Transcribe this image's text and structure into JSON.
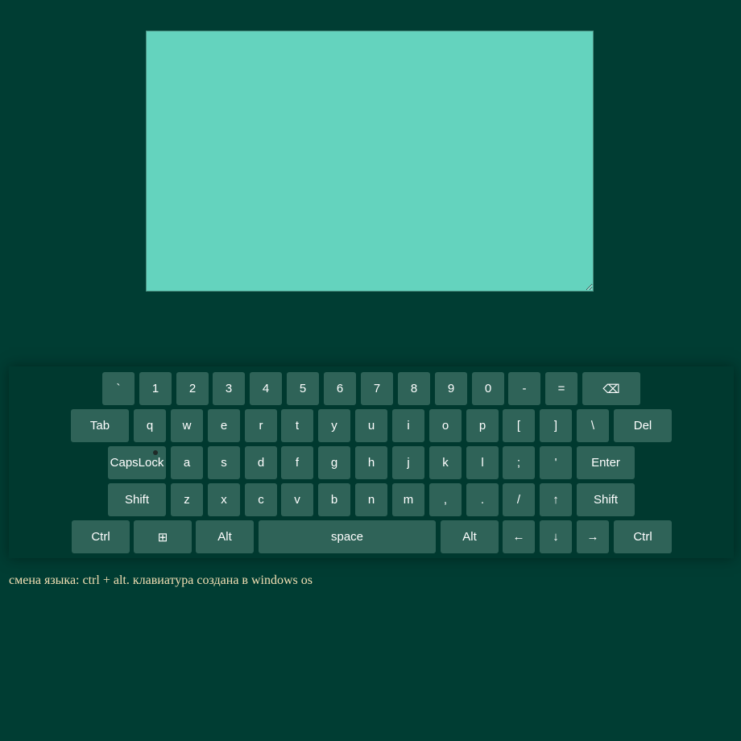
{
  "colors": {
    "background": "#003d33",
    "textarea": "#64d3be",
    "keyboard_panel": "#00392f",
    "key": "#2f6358",
    "key_text": "#ffffff",
    "note_text": "#f2dfb3"
  },
  "textarea": {
    "value": ""
  },
  "keyboard": {
    "rows": [
      [
        "`",
        "1",
        "2",
        "3",
        "4",
        "5",
        "6",
        "7",
        "8",
        "9",
        "0",
        "-",
        "=",
        "⌫"
      ],
      [
        "Tab",
        "q",
        "w",
        "e",
        "r",
        "t",
        "y",
        "u",
        "i",
        "o",
        "p",
        "[",
        "]",
        "\\",
        "Del"
      ],
      [
        "CapsLock",
        "a",
        "s",
        "d",
        "f",
        "g",
        "h",
        "j",
        "k",
        "l",
        ";",
        "'",
        "Enter"
      ],
      [
        "Shift",
        "z",
        "x",
        "c",
        "v",
        "b",
        "n",
        "m",
        ",",
        ".",
        "/",
        "↑",
        "Shift"
      ],
      [
        "Ctrl",
        "⊞",
        "Alt",
        "space",
        "Alt",
        "←",
        "↓",
        "→",
        "Ctrl"
      ]
    ]
  },
  "footer": {
    "note": "смена языка: ctrl + alt. клавиатура создана в windows os"
  }
}
